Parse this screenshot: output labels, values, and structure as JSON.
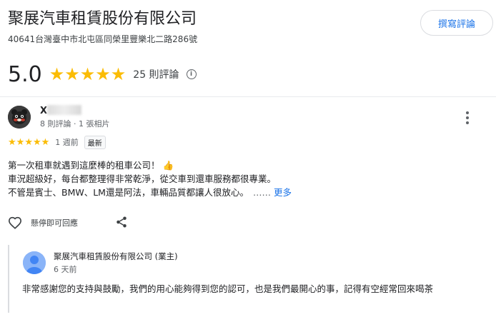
{
  "business": {
    "name": "聚展汽車租賃股份有限公司",
    "address": "40641台灣臺中市北屯區同榮里豐樂北二路286號"
  },
  "header": {
    "write_review_label": "撰寫評論"
  },
  "summary": {
    "rating": "5.0",
    "stars": 5,
    "review_count_label": "25 則評論"
  },
  "review": {
    "reviewer_name": "X",
    "reviewer_meta": "8 則評論 · 1 張相片",
    "stars": 5,
    "time_ago": "1 週前",
    "badge": "最新",
    "text_lines": [
      "第一次租車就遇到這麼棒的租車公司！",
      "車況超級好，每台都整理得非常乾淨，從交車到還車服務都很專業。",
      "不管是賓士、BMW、LM還是阿法，車輛品質都讓人很放心。"
    ],
    "thumb_emoji": "👍",
    "ellipsis": "……",
    "more_label": "更多",
    "helpful_label": "懸停即可回應"
  },
  "owner_reply": {
    "name": "聚展汽車租賃股份有限公司 (業主)",
    "time_ago": "6 天前",
    "text": "非常感謝您的支持與鼓勵，我們的用心能夠得到您的認可，也是我們最開心的事，記得有空經常回來喝茶"
  },
  "colors": {
    "star": "#fbbc04",
    "link": "#1a73e8",
    "text_primary": "#202124",
    "text_secondary": "#5f6368"
  },
  "icons": {
    "info": "info-icon",
    "more": "more-vert-icon",
    "heart": "heart-icon",
    "share": "share-icon"
  }
}
